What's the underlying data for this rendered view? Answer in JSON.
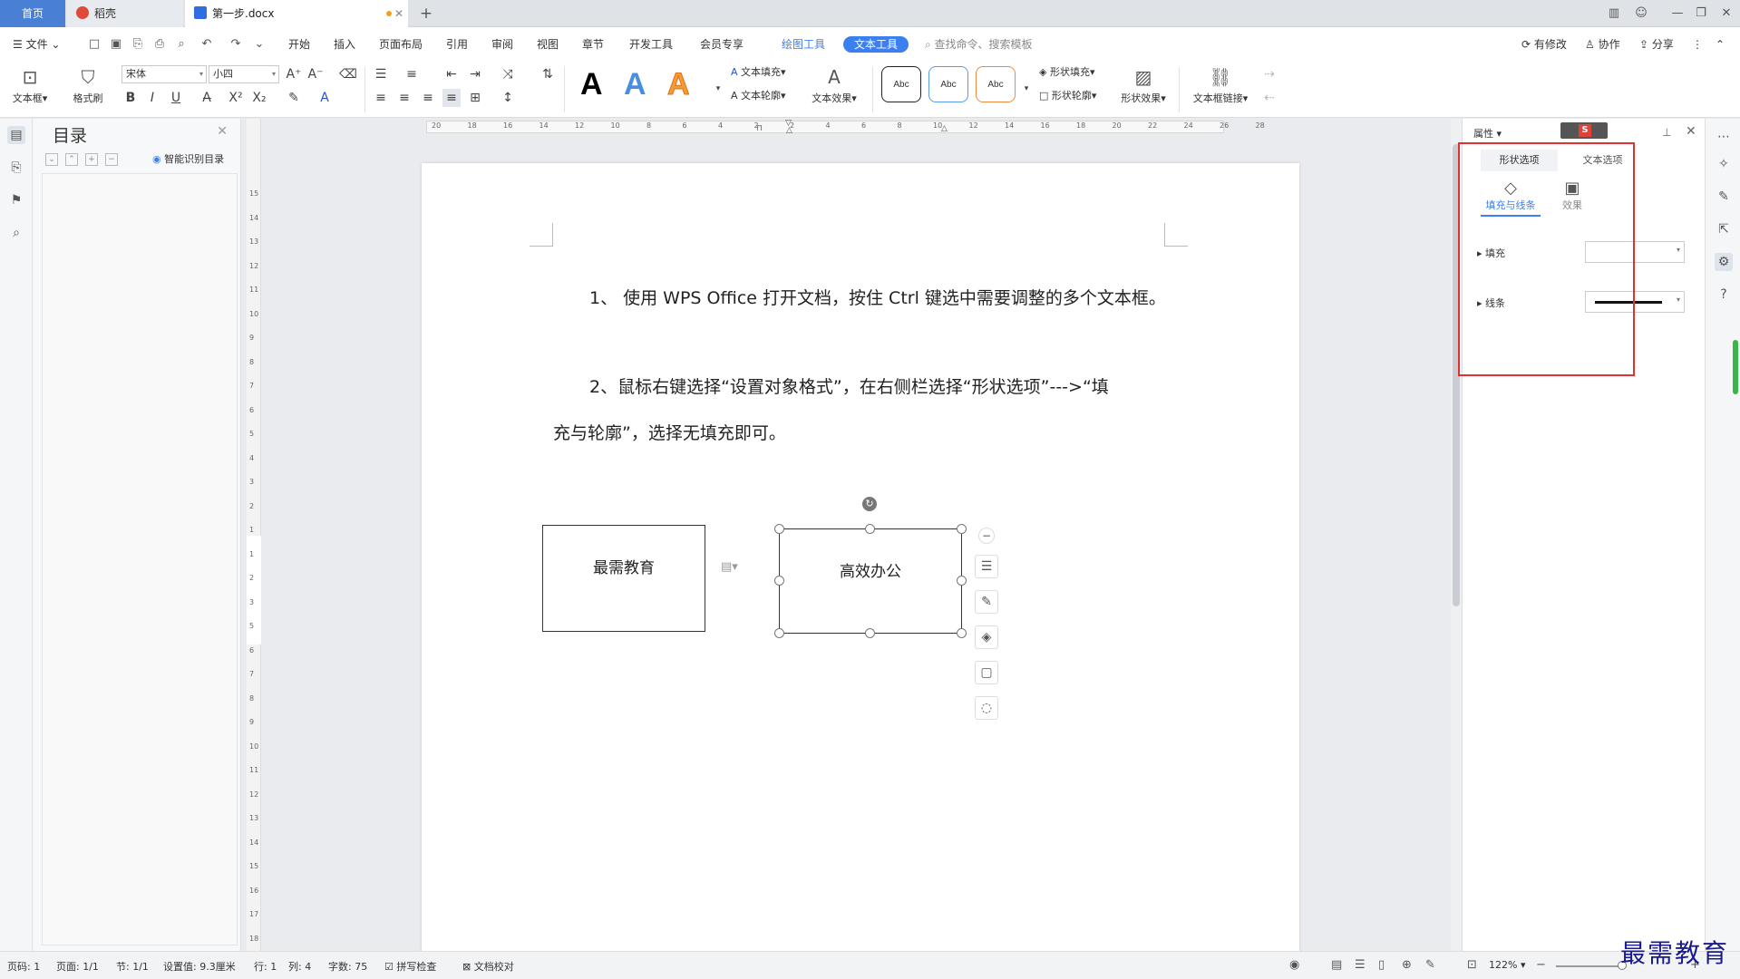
{
  "titlebar": {
    "tabs": [
      {
        "label": "首页"
      },
      {
        "label": "稻壳"
      },
      {
        "label": "第一步.docx"
      }
    ],
    "new_tab": "+"
  },
  "menu": {
    "file": "文件",
    "items": [
      "开始",
      "插入",
      "页面布局",
      "引用",
      "审阅",
      "视图",
      "章节",
      "开发工具",
      "会员专享"
    ],
    "drawing_tools": "绘图工具",
    "text_tools": "文本工具",
    "search_placeholder": "查找命令、搜索模板",
    "right": {
      "modified": "有修改",
      "collab": "协作",
      "share": "分享"
    }
  },
  "ribbon": {
    "textbox": "文本框",
    "format_painter": "格式刷",
    "font_name": "宋体",
    "font_size": "小四",
    "text_fill": "文本填充",
    "text_outline": "文本轮廓",
    "text_effect": "文本效果",
    "abc": "Abc",
    "shape_fill": "形状填充",
    "shape_outline": "形状轮廓",
    "shape_effect": "形状效果",
    "textbox_link": "文本框链接",
    "bigA": "A"
  },
  "toc": {
    "title": "目录",
    "smart": "智能识别目录"
  },
  "document": {
    "para1": "1、 使用 WPS Office 打开文档，按住 Ctrl 键选中需要调整的多个文本框。",
    "para2_line1": "2、鼠标右键选择“设置对象格式”，在右侧栏选择“形状选项”--->“填",
    "para2_line2": "充与轮廓”，选择无填充即可。",
    "box1": "最需教育",
    "box2": "高效办公"
  },
  "ruler": {
    "h_ticks": [
      "20",
      "18",
      "16",
      "14",
      "12",
      "10",
      "8",
      "6",
      "4",
      "2",
      "2",
      "4",
      "6",
      "8",
      "10",
      "12",
      "14",
      "16",
      "18",
      "20",
      "22",
      "24",
      "26",
      "28"
    ],
    "v_ticks": [
      "15",
      "14",
      "13",
      "12",
      "11",
      "10",
      "9",
      "8",
      "7",
      "6",
      "5",
      "4",
      "3",
      "2",
      "1",
      "1",
      "2",
      "3",
      "5",
      "6",
      "7",
      "8",
      "9",
      "10",
      "11",
      "12",
      "13",
      "14",
      "15",
      "16",
      "17",
      "18"
    ]
  },
  "props": {
    "header": "属性",
    "tab_shape": "形状选项",
    "tab_text": "文本选项",
    "sub_fill_line": "填充与线条",
    "sub_effect": "效果",
    "fill": "填充",
    "line": "线条"
  },
  "status": {
    "page_num": "页码: 1",
    "pages": "页面: 1/1",
    "section": "节: 1/1",
    "setting": "设置值: 9.3厘米",
    "row": "行: 1",
    "col": "列: 4",
    "words": "字数: 75",
    "spell": "拼写检查",
    "proof": "文档校对",
    "zoom": "122%"
  },
  "watermark": "最需教育",
  "colors": {
    "accent": "#3b7ff0",
    "red_highlight": "#e03030",
    "home_tab": "#4a7fd6"
  }
}
